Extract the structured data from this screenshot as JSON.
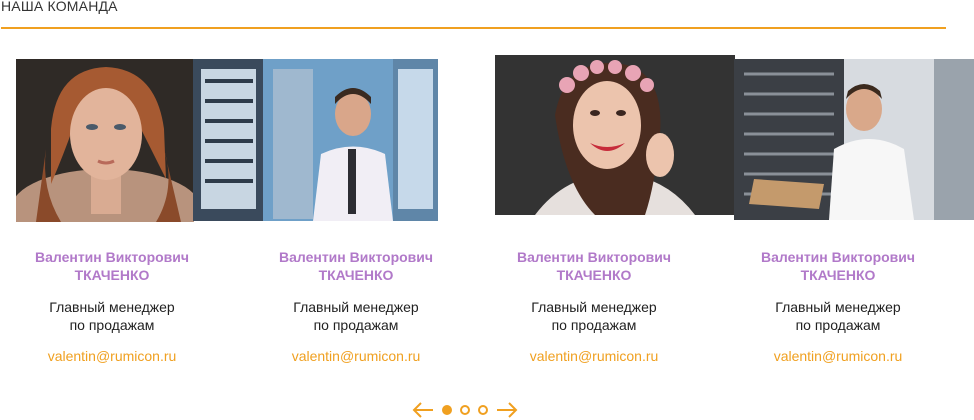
{
  "section": {
    "title": "НАША КОМАНДА"
  },
  "accent_color": "#f0a020",
  "name_color": "#b179c9",
  "team": [
    {
      "first_name": "Валентин Викторович",
      "last_name": "ТКАЧЕНКО",
      "role_line1": "Главный менеджер",
      "role_line2": "по продажам",
      "email": "valentin@rumicon.ru"
    },
    {
      "first_name": "Валентин Викторович",
      "last_name": "ТКАЧЕНКО",
      "role_line1": "Главный менеджер",
      "role_line2": "по продажам",
      "email": "valentin@rumicon.ru"
    },
    {
      "first_name": "Валентин Викторович",
      "last_name": "ТКАЧЕНКО",
      "role_line1": "Главный менеджер",
      "role_line2": "по продажам",
      "email": "valentin@rumicon.ru"
    },
    {
      "first_name": "Валентин Викторович",
      "last_name": "ТКАЧЕНКО",
      "role_line1": "Главный менеджер",
      "role_line2": "по продажам",
      "email": "valentin@rumicon.ru"
    }
  ],
  "pager": {
    "prev_icon": "arrow-left-icon",
    "next_icon": "arrow-right-icon",
    "pages": 3,
    "active_page": 1
  }
}
